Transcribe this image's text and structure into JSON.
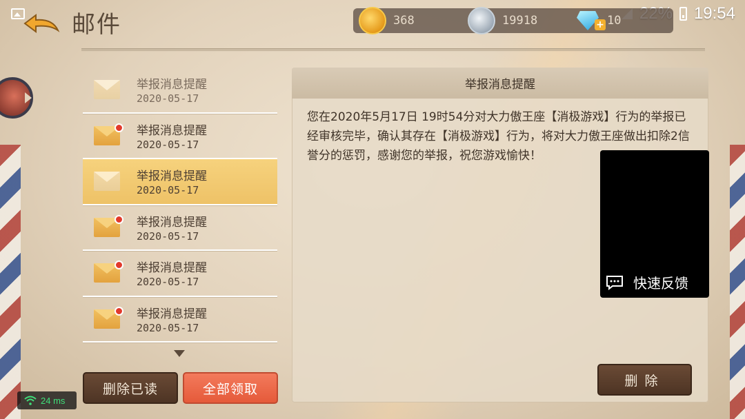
{
  "status_bar": {
    "battery": "22%",
    "time": "19:54"
  },
  "header": {
    "title": "邮件"
  },
  "currency": {
    "gold": "368",
    "silver": "19918",
    "diamond": "10"
  },
  "mail_list": {
    "items": [
      {
        "title": "举报消息提醒",
        "date": "2020-05-17",
        "read": true,
        "selected": false
      },
      {
        "title": "举报消息提醒",
        "date": "2020-05-17",
        "read": false,
        "selected": false
      },
      {
        "title": "举报消息提醒",
        "date": "2020-05-17",
        "read": true,
        "selected": true
      },
      {
        "title": "举报消息提醒",
        "date": "2020-05-17",
        "read": false,
        "selected": false
      },
      {
        "title": "举报消息提醒",
        "date": "2020-05-17",
        "read": false,
        "selected": false
      },
      {
        "title": "举报消息提醒",
        "date": "2020-05-17",
        "read": false,
        "selected": false
      }
    ],
    "delete_read_label": "删除已读",
    "claim_all_label": "全部领取"
  },
  "detail": {
    "title": "举报消息提醒",
    "body": "您在2020年5月17日 19时54分对大力傲王座【消极游戏】行为的举报已经审核完毕，确认其存在【消极游戏】行为，将对大力傲王座做出扣除2信誉分的惩罚，感谢您的举报，祝您游戏愉快！",
    "delete_label": "删除"
  },
  "feedback": {
    "label": "快速反馈"
  },
  "network": {
    "ping": "24 ms"
  },
  "colors": {
    "accent": "#eec267",
    "claim_button": "#e55a3a",
    "unread_dot": "#e23a2c"
  }
}
